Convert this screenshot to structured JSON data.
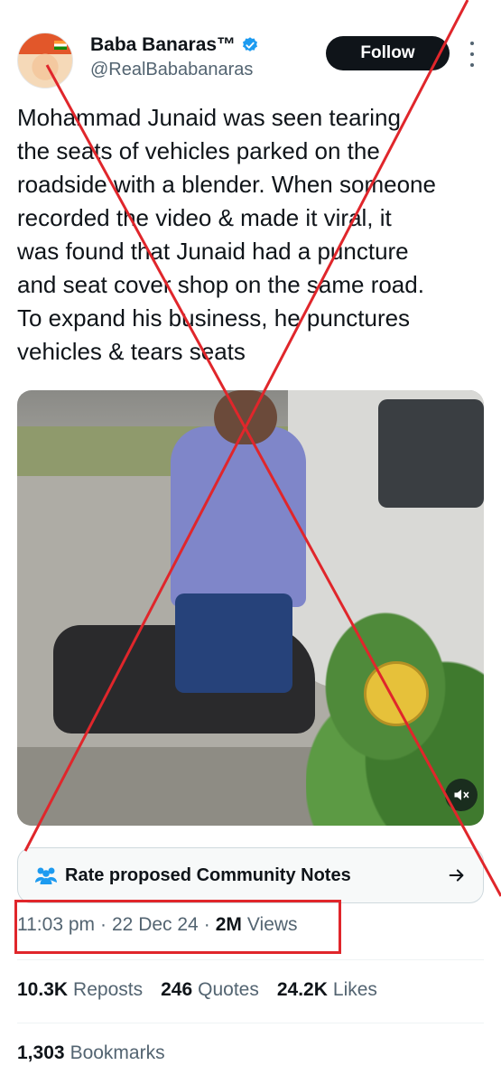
{
  "user": {
    "display_name": "Baba Banaras™",
    "handle": "@RealBababanaras",
    "verified": true,
    "follow_label": "Follow"
  },
  "tweet": {
    "text": "Mohammad Junaid was seen tearing\nthe seats of vehicles parked on the\nroadside with a blender. When someone\nrecorded the video & made it viral, it\nwas found that Junaid had a puncture\nand seat cover shop on the same road.\nTo expand his business, he punctures\nvehicles & tears seats"
  },
  "media": {
    "type": "video",
    "muted": true
  },
  "community_notes": {
    "label": "Rate proposed Community Notes"
  },
  "meta": {
    "time": "11:03 pm",
    "separator": "·",
    "date": "22 Dec 24",
    "views_count": "2M",
    "views_label": "Views"
  },
  "stats": {
    "reposts_count": "10.3K",
    "reposts_label": "Reposts",
    "quotes_count": "246",
    "quotes_label": "Quotes",
    "likes_count": "24.2K",
    "likes_label": "Likes",
    "bookmarks_count": "1,303",
    "bookmarks_label": "Bookmarks"
  },
  "colors": {
    "accent": "#1d9bf0",
    "highlight_box": "#e0262b",
    "cross_lines": "#e0262b",
    "follow_button": "#0f1419"
  }
}
